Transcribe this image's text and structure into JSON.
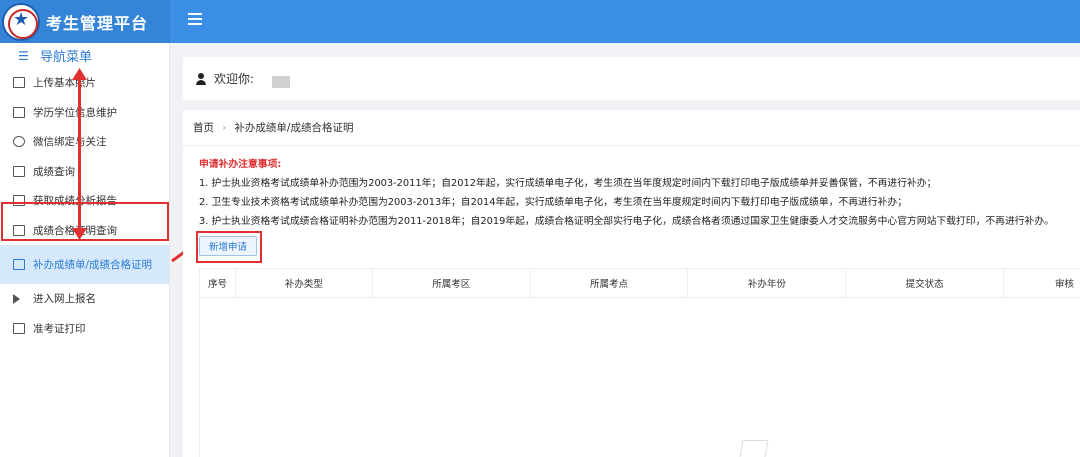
{
  "header": {
    "app_title": "考生管理平台",
    "menu_icon": "hamburger-menu-icon",
    "logo": "school-emblem-logo"
  },
  "sidebar": {
    "heading": "导航菜单",
    "items": [
      {
        "label": "上传基本照片",
        "icon": "image-icon"
      },
      {
        "label": "学历学位信息维护",
        "icon": "book-icon"
      },
      {
        "label": "微信绑定与关注",
        "icon": "wechat-icon"
      },
      {
        "label": "成绩查询",
        "icon": "document-icon"
      },
      {
        "label": "获取成绩分析报告",
        "icon": "edit-icon"
      },
      {
        "label": "成绩合格证明查询",
        "icon": "document-icon"
      },
      {
        "label": "补办成绩单/成绩合格证明",
        "icon": "document-icon",
        "active": true
      },
      {
        "label": "进入网上报名",
        "icon": "send-icon"
      },
      {
        "label": "准考证打印",
        "icon": "card-icon"
      }
    ]
  },
  "welcome": {
    "text": "欢迎你:"
  },
  "breadcrumb": {
    "home": "首页",
    "current": "补办成绩单/成绩合格证明"
  },
  "notice": {
    "title": "申请补办注意事项:",
    "lines": [
      "1. 护士执业资格考试成绩单补办范围为2003-2011年；自2012年起，实行成绩单电子化，考生须在当年度规定时间内下载打印电子版成绩单并妥善保管，不再进行补办；",
      "2. 卫生专业技术资格考试成绩单补办范围为2003-2013年；自2014年起，实行成绩单电子化，考生须在当年度规定时间内下载打印电子版成绩单，不再进行补办；",
      "3. 护士执业资格考试成绩合格证明补办范围为2011-2018年；自2019年起，成绩合格证明全部实行电子化，成绩合格者须通过国家卫生健康委人才交流服务中心官方网站下载打印，不再进行补办。"
    ]
  },
  "actions": {
    "add_button": "新增申请"
  },
  "table": {
    "columns": [
      "序号",
      "补办类型",
      "所属考区",
      "所属考点",
      "补办年份",
      "提交状态",
      "审核"
    ]
  },
  "colors": {
    "header_blue": "#3a8ee6",
    "annotation_red": "#e03131",
    "active_bg": "#d6e8fb"
  }
}
